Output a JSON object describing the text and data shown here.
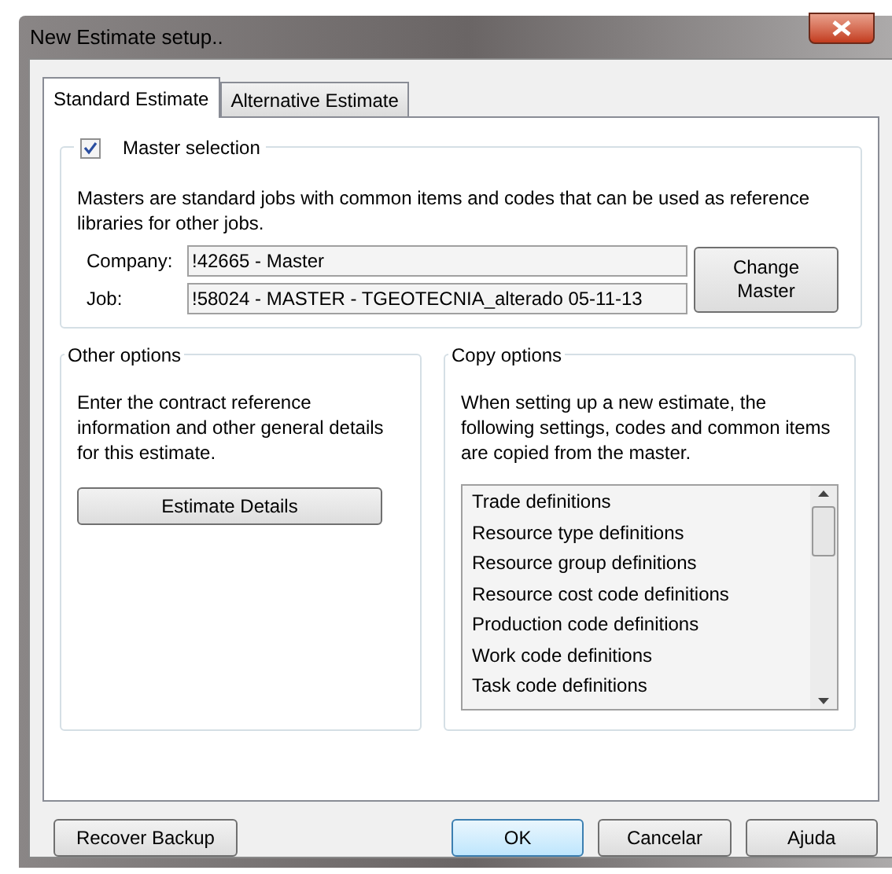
{
  "window": {
    "title": "New Estimate setup.."
  },
  "tabs": [
    {
      "label": "Standard Estimate",
      "selected": true
    },
    {
      "label": "Alternative Estimate",
      "selected": false
    }
  ],
  "master_selection": {
    "label": "Master selection",
    "checked": true,
    "description": "Masters are standard jobs with common items and codes that can be used as reference libraries for other jobs.",
    "fields": [
      {
        "label": "Company:",
        "value": "!42665 - Master"
      },
      {
        "label": "Job:",
        "value": "!58024 - MASTER - TGEOTECNIA_alterado 05-11-13"
      }
    ],
    "change_button": "Change Master"
  },
  "other_options": {
    "title": "Other options",
    "description": "Enter the contract reference information and other general details for this estimate.",
    "button": "Estimate Details"
  },
  "copy_options": {
    "title": "Copy options",
    "description": "When setting up a new estimate, the following settings, codes and common items are copied from the master.",
    "items": [
      "Trade definitions",
      "Resource type definitions",
      "Resource group definitions",
      "Resource cost code definitions",
      "Production code definitions",
      "Work code definitions",
      "Task code definitions"
    ]
  },
  "buttons": [
    {
      "label": "Recover Backup",
      "default": false
    },
    {
      "label": "OK",
      "default": true
    },
    {
      "label": "Cancelar",
      "default": false
    },
    {
      "label": "Ajuda",
      "default": false
    }
  ]
}
